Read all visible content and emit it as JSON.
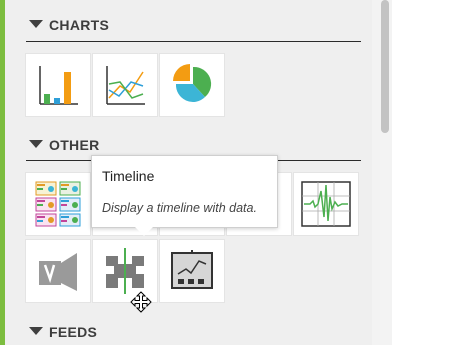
{
  "sections": {
    "charts": {
      "label": "CHARTS",
      "items": [
        "bar-chart",
        "line-chart",
        "pie-chart"
      ]
    },
    "other": {
      "label": "OTHER",
      "items": [
        "dashboard-grid",
        "placeholder",
        "placeholder",
        "placeholder",
        "waveform",
        "video-player",
        "timeline",
        "kpi-screen"
      ]
    },
    "feeds": {
      "label": "FEEDS"
    }
  },
  "tooltip": {
    "title": "Timeline",
    "description": "Display a timeline with data."
  },
  "colors": {
    "accent": "#7cbd3f",
    "bar_orange": "#f39c12",
    "bar_green": "#4caf50",
    "bar_blue": "#2e9fd8",
    "pie_orange": "#f39c12",
    "pie_green": "#4caf50",
    "pie_blue": "#3cb5d6"
  }
}
